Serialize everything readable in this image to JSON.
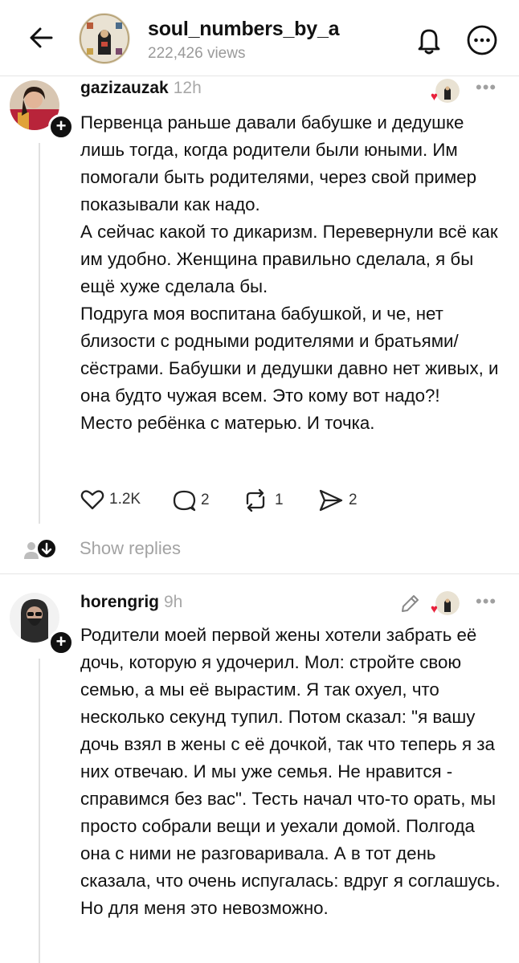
{
  "header": {
    "title": "soul_numbers_by_a",
    "views": "222,426 views"
  },
  "comments": [
    {
      "username": "gazizauzak",
      "time": "12h",
      "paragraphs": [
        "Первенца раньше давали бабушке и дедушке лишь тогда, когда родители были юными. Им помогали быть родителями, через свой пример показывали как надо.",
        "А сейчас какой то дикаризм. Перевернули всё как им удобно. Женщина правильно сделала, я бы ещё хуже сделала бы.",
        "Подруга моя воспитана бабушкой, и че, нет близости с родными родителями и братьями/сёстрами. Бабушки и дедушки давно нет живых, и она будто чужая всем. Это кому вот надо?!",
        "Место ребёнка с матерью. И точка."
      ],
      "likes": "1.2K",
      "replies": "2",
      "reposts": "1",
      "shares": "2",
      "show_replies": "Show replies"
    },
    {
      "username": "horengrig",
      "time": "9h",
      "paragraphs": [
        "Родители моей первой жены хотели забрать её дочь, которую я удочерил. Мол: стройте свою семью, а мы её вырастим. Я так охуел, что несколько секунд тупил. Потом сказал: \"я вашу дочь взял в жены с её дочкой, так что теперь я за них отвечаю. И мы уже семья. Не нравится - справимся без вас\". Тесть начал что-то орать, мы просто собрали вещи и уехали домой. Полгода она с ними не разговаривала. А в тот день сказала, что очень испугалась: вдруг я соглашусь. Но для меня это невозможно."
      ]
    }
  ],
  "icons": {
    "back": "arrow-left-icon",
    "bell": "bell-icon",
    "more": "more-horizontal-icon",
    "heart": "heart-icon",
    "reply": "comment-bubble-icon",
    "repost": "repost-icon",
    "share": "send-icon",
    "edit": "pencil-icon"
  },
  "colors": {
    "liked_heart": "#e8213b",
    "muted_text": "#a3a3a3"
  }
}
